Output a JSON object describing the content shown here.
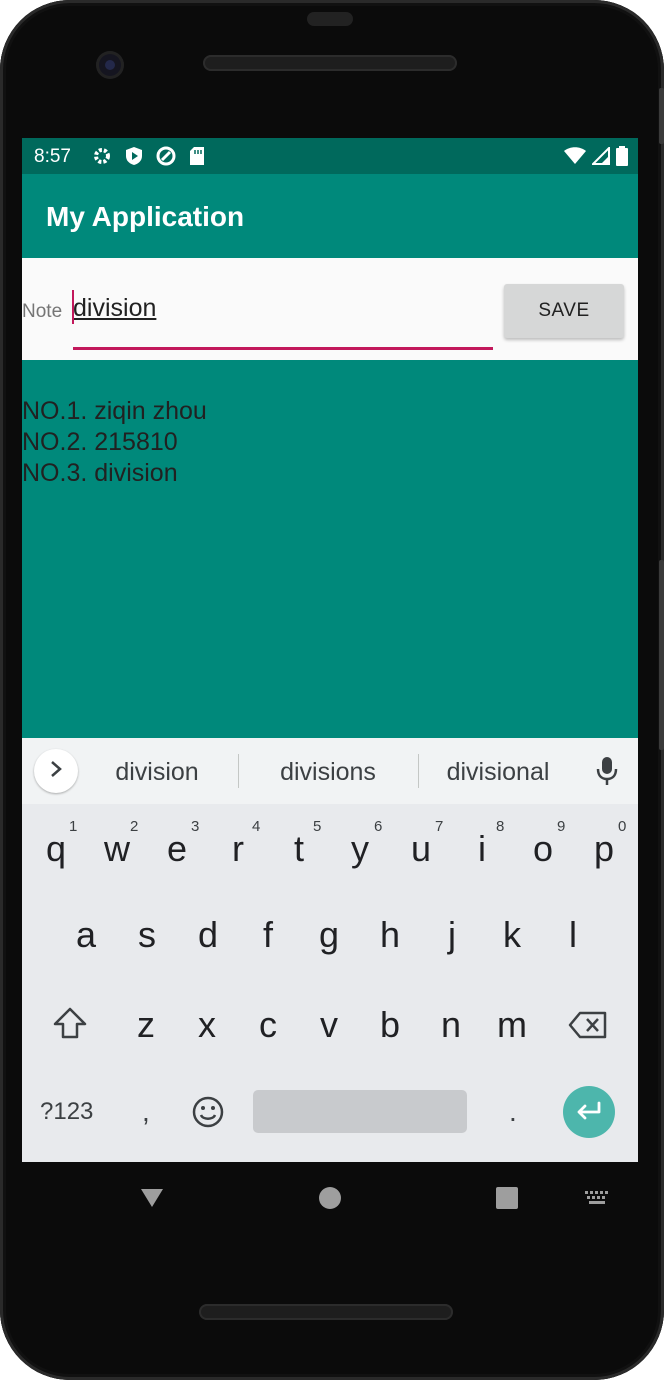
{
  "status_bar": {
    "time": "8:57",
    "left_icons": [
      "gear-icon",
      "play-protect-icon",
      "data-saver-icon",
      "sd-card-icon"
    ],
    "right_icons": [
      "wifi-icon",
      "signal-icon",
      "battery-icon"
    ]
  },
  "app_bar": {
    "title": "My Application",
    "color": "#00897b"
  },
  "input": {
    "label": "Note",
    "value": "division",
    "accent": "#c2185b"
  },
  "save_button": {
    "label": "SAVE"
  },
  "notes": [
    "NO.1. ziqin zhou",
    "NO.2. 215810",
    "NO.3. division"
  ],
  "keyboard": {
    "suggestions": [
      "division",
      "divisions",
      "divisional"
    ],
    "row1": [
      {
        "key": "q",
        "hint": "1"
      },
      {
        "key": "w",
        "hint": "2"
      },
      {
        "key": "e",
        "hint": "3"
      },
      {
        "key": "r",
        "hint": "4"
      },
      {
        "key": "t",
        "hint": "5"
      },
      {
        "key": "y",
        "hint": "6"
      },
      {
        "key": "u",
        "hint": "7"
      },
      {
        "key": "i",
        "hint": "8"
      },
      {
        "key": "o",
        "hint": "9"
      },
      {
        "key": "p",
        "hint": "0"
      }
    ],
    "row2": [
      "a",
      "s",
      "d",
      "f",
      "g",
      "h",
      "j",
      "k",
      "l"
    ],
    "row3": [
      "z",
      "x",
      "c",
      "v",
      "b",
      "n",
      "m"
    ],
    "symbols_label": "?123",
    "comma": ",",
    "period": ".",
    "enter_color": "#4db6ac"
  },
  "nav_bar": {
    "icons": [
      "back-icon",
      "home-icon",
      "recents-icon",
      "keyboard-switch-icon"
    ]
  }
}
